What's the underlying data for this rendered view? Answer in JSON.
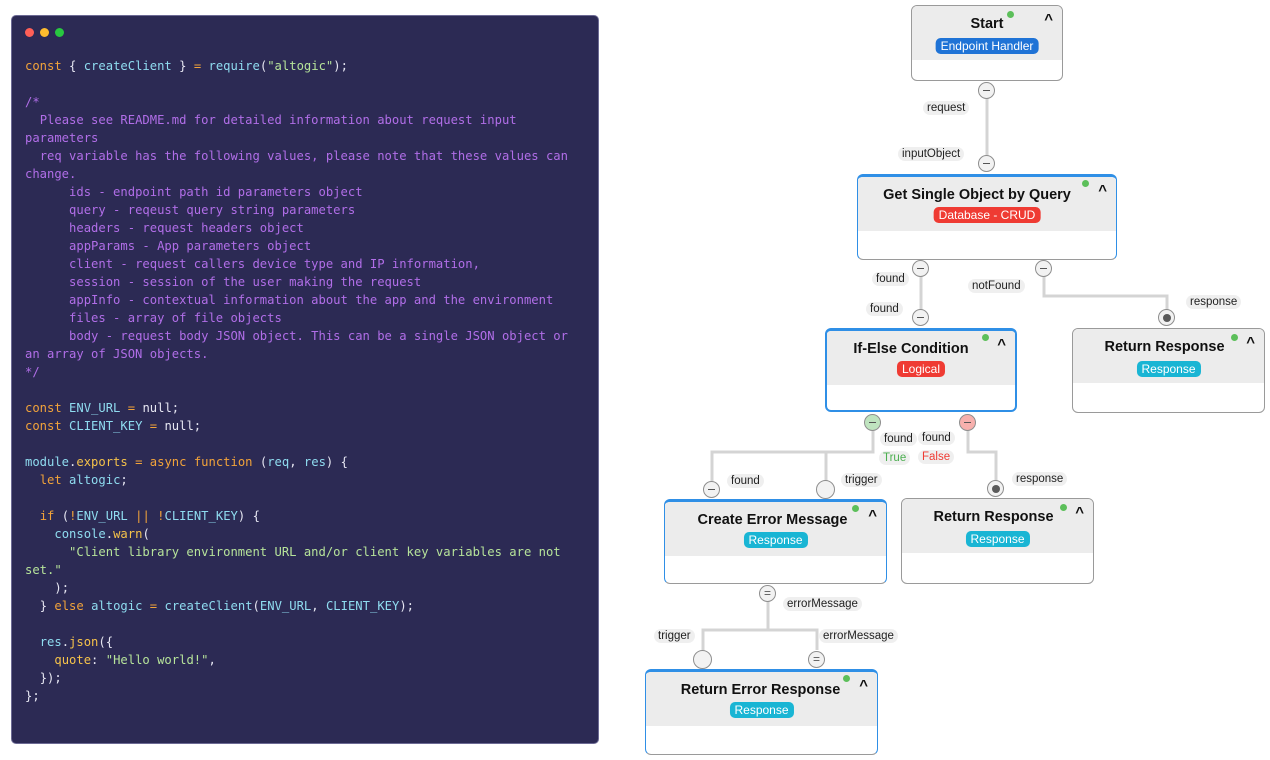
{
  "editor": {
    "window_controls": [
      "close",
      "minimize",
      "maximize"
    ],
    "code_lines": [
      "const { createClient } = require(\"altogic\");",
      "",
      "/*",
      "  Please see README.md for detailed information about request input parameters",
      "  req variable has the following values, please note that these values can change.",
      "      ids - endpoint path id parameters object",
      "      query - reqeust query string parameters",
      "      headers - request headers object",
      "      appParams - App parameters object",
      "      client - request callers device type and IP information,",
      "      session - session of the user making the request",
      "      appInfo - contextual information about the app and the environment",
      "      files - array of file objects",
      "      body - request body JSON object. This can be a single JSON object or an array of JSON objects.",
      "*/",
      "",
      "const ENV_URL = null;",
      "const CLIENT_KEY = null;",
      "",
      "module.exports = async function (req, res) {",
      "  let altogic;",
      "",
      "  if (!ENV_URL || !CLIENT_KEY) {",
      "    console.warn(",
      "      \"Client library environment URL and/or client key variables are not set.\"",
      "    );",
      "  } else altogic = createClient(ENV_URL, CLIENT_KEY);",
      "",
      "  res.json({",
      "    quote: \"Hello world!\",",
      "  });",
      "};"
    ]
  },
  "flow": {
    "nodes": {
      "start": {
        "title": "Start",
        "badge": "Endpoint Handler",
        "badge_color": "#1f73d6"
      },
      "get_single": {
        "title": "Get Single Object by Query",
        "badge": "Database - CRUD",
        "badge_color": "#ef3b33"
      },
      "if_else": {
        "title": "If-Else Condition",
        "badge": "Logical",
        "badge_color": "#ef3b33"
      },
      "return_response_1": {
        "title": "Return Response",
        "badge": "Response",
        "badge_color": "#19b5d4"
      },
      "create_error": {
        "title": "Create Error Message",
        "badge": "Response",
        "badge_color": "#19b5d4"
      },
      "return_response_2": {
        "title": "Return Response",
        "badge": "Response",
        "badge_color": "#19b5d4"
      },
      "return_error": {
        "title": "Return Error Response",
        "badge": "Response",
        "badge_color": "#19b5d4"
      }
    },
    "collapse_glyph": "^",
    "labels": {
      "request": "request",
      "inputObject": "inputObject",
      "found_out": "found",
      "notFound": "notFound",
      "found_in": "found",
      "response_1": "response",
      "true_found": "found",
      "false_found": "found",
      "true_label": "True",
      "false_label": "False",
      "ce_found": "found",
      "ce_trigger": "trigger",
      "response_2": "response",
      "errorMessage_out": "errorMessage",
      "re_trigger": "trigger",
      "re_errorMessage": "errorMessage"
    },
    "colors": {
      "selected_border": "#2f8fe6",
      "status_ok": "#5cbf5a",
      "true": "#4caf50",
      "false": "#ef3b33"
    }
  }
}
